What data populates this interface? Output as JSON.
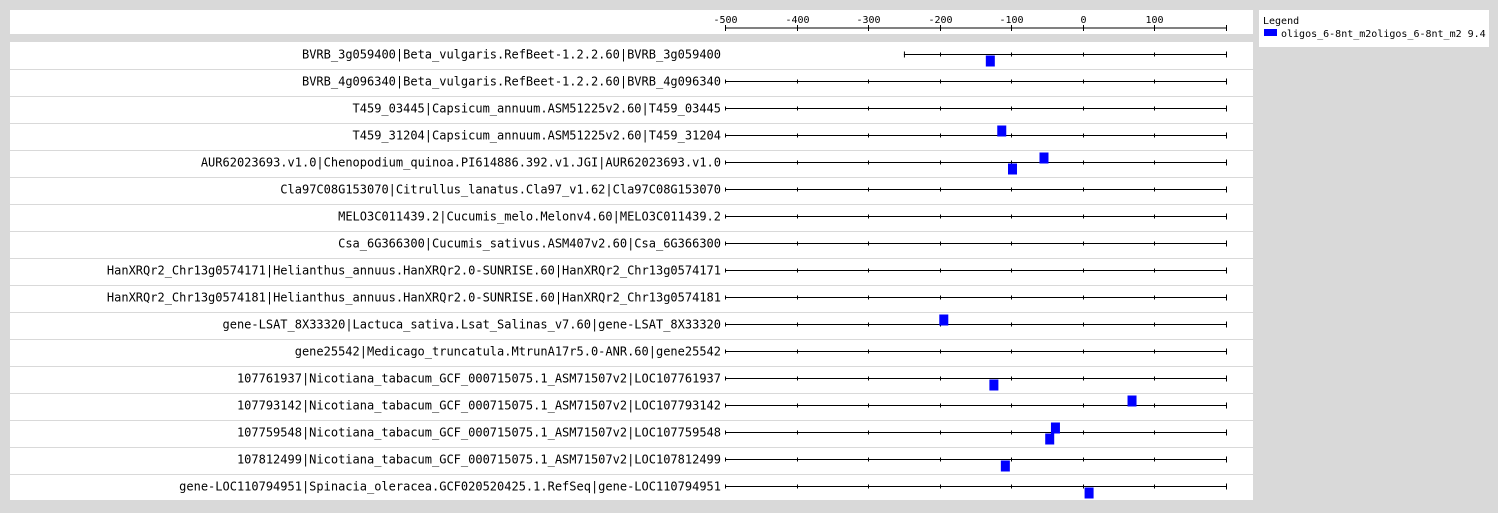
{
  "chart_data": {
    "type": "scatter",
    "x_ticks": [
      -500,
      -400,
      -300,
      -200,
      -100,
      0,
      100
    ],
    "xlim": [
      -500,
      200
    ],
    "legend": {
      "title": "Legend",
      "position": "top-right",
      "entries": [
        {
          "label": "oligos_6-8nt_m2oligos_6-8nt_m2 9.4",
          "color": "#0000ff"
        }
      ]
    },
    "rows": [
      {
        "label": "BVRB_3g059400|Beta_vulgaris.RefBeet-1.2.2.60|BVRB_3g059400",
        "line_start": -250,
        "hits": [
          {
            "x": -130,
            "strand": "-"
          }
        ]
      },
      {
        "label": "BVRB_4g096340|Beta_vulgaris.RefBeet-1.2.2.60|BVRB_4g096340",
        "line_start": -500,
        "hits": []
      },
      {
        "label": "T459_03445|Capsicum_annuum.ASM51225v2.60|T459_03445",
        "line_start": -500,
        "hits": []
      },
      {
        "label": "T459_31204|Capsicum_annuum.ASM51225v2.60|T459_31204",
        "line_start": -500,
        "hits": [
          {
            "x": -114,
            "strand": "+"
          }
        ]
      },
      {
        "label": "AUR62023693.v1.0|Chenopodium_quinoa.PI614886.392.v1.JGI|AUR62023693.v1.0",
        "line_start": -500,
        "hits": [
          {
            "x": -55,
            "strand": "+"
          },
          {
            "x": -99,
            "strand": "-"
          }
        ]
      },
      {
        "label": "Cla97C08G153070|Citrullus_lanatus.Cla97_v1.62|Cla97C08G153070",
        "line_start": -500,
        "hits": []
      },
      {
        "label": "MELO3C011439.2|Cucumis_melo.Melonv4.60|MELO3C011439.2",
        "line_start": -500,
        "hits": []
      },
      {
        "label": "Csa_6G366300|Cucumis_sativus.ASM407v2.60|Csa_6G366300",
        "line_start": -500,
        "hits": []
      },
      {
        "label": "HanXRQr2_Chr13g0574171|Helianthus_annuus.HanXRQr2.0-SUNRISE.60|HanXRQr2_Chr13g0574171",
        "line_start": -500,
        "hits": []
      },
      {
        "label": "HanXRQr2_Chr13g0574181|Helianthus_annuus.HanXRQr2.0-SUNRISE.60|HanXRQr2_Chr13g0574181",
        "line_start": -500,
        "hits": []
      },
      {
        "label": "gene-LSAT_8X33320|Lactuca_sativa.Lsat_Salinas_v7.60|gene-LSAT_8X33320",
        "line_start": -500,
        "hits": [
          {
            "x": -195,
            "strand": "+"
          }
        ]
      },
      {
        "label": "gene25542|Medicago_truncatula.MtrunA17r5.0-ANR.60|gene25542",
        "line_start": -500,
        "hits": []
      },
      {
        "label": "107761937|Nicotiana_tabacum_GCF_000715075.1_ASM71507v2|LOC107761937",
        "line_start": -500,
        "hits": [
          {
            "x": -125,
            "strand": "-"
          }
        ]
      },
      {
        "label": "107793142|Nicotiana_tabacum_GCF_000715075.1_ASM71507v2|LOC107793142",
        "line_start": -500,
        "hits": [
          {
            "x": 68,
            "strand": "+"
          }
        ]
      },
      {
        "label": "107759548|Nicotiana_tabacum_GCF_000715075.1_ASM71507v2|LOC107759548",
        "line_start": -500,
        "hits": [
          {
            "x": -39,
            "strand": "+"
          },
          {
            "x": -47,
            "strand": "-"
          }
        ]
      },
      {
        "label": "107812499|Nicotiana_tabacum_GCF_000715075.1_ASM71507v2|LOC107812499",
        "line_start": -500,
        "hits": [
          {
            "x": -109,
            "strand": "-"
          }
        ]
      },
      {
        "label": "gene-LOC110794951|Spinacia_oleracea.GCF020520425.1.RefSeq|gene-LOC110794951",
        "line_start": -500,
        "hits": [
          {
            "x": 8,
            "strand": "-"
          }
        ]
      }
    ]
  }
}
